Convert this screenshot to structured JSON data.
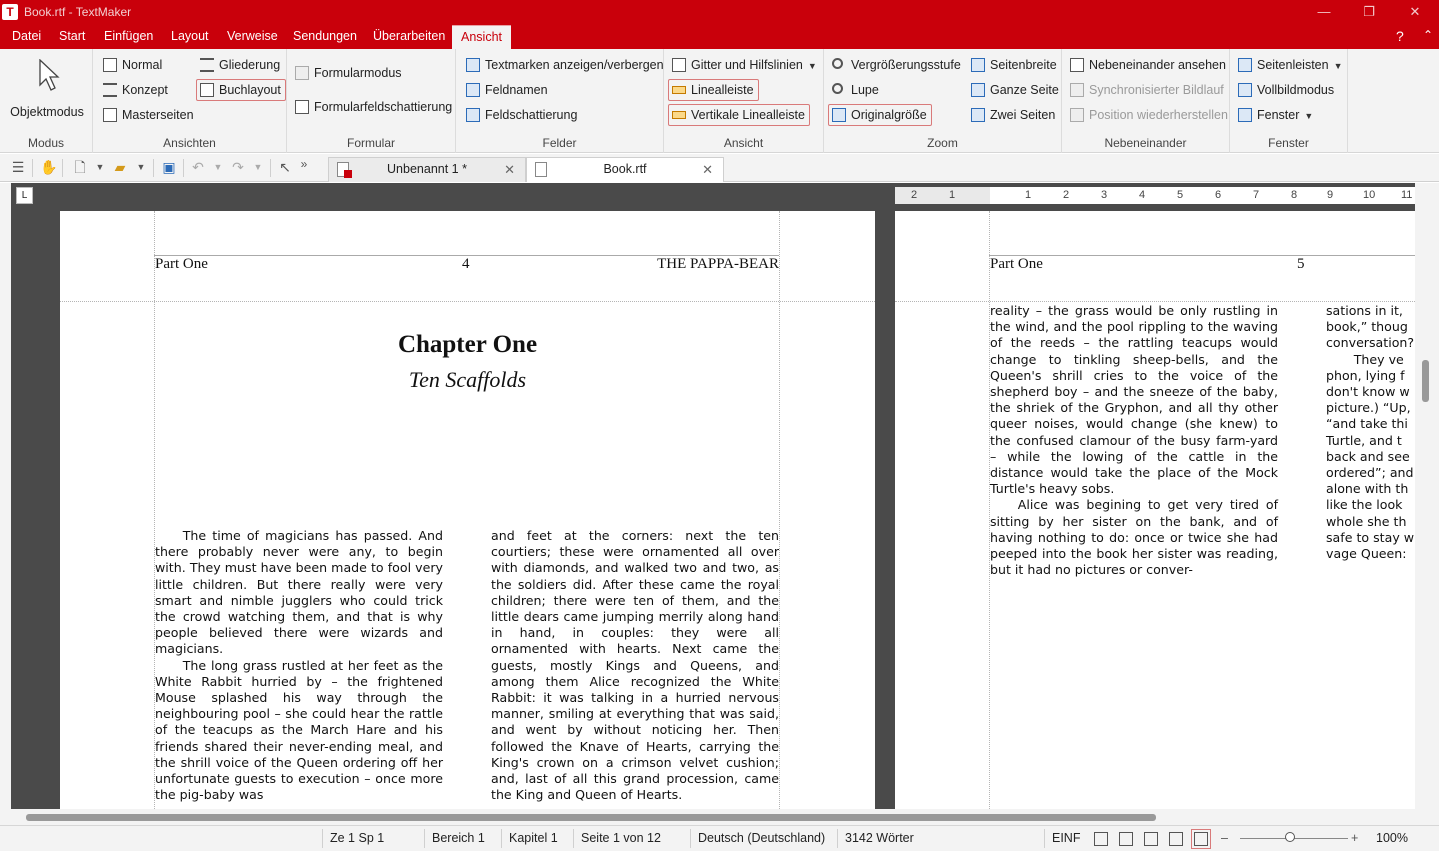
{
  "window": {
    "title": "Book.rtf - TextMaker",
    "app_icon_letter": "T",
    "controls": {
      "minimize": "—",
      "maximize": "❐",
      "close": "✕"
    }
  },
  "menu": {
    "tabs": [
      "Datei",
      "Start",
      "Einfügen",
      "Layout",
      "Verweise",
      "Sendungen",
      "Überarbeiten",
      "Ansicht"
    ],
    "active_tab": "Ansicht",
    "help": "?",
    "collapse": "⌃"
  },
  "ribbon": {
    "modus": {
      "label": "Modus",
      "objektmodus": "Objektmodus"
    },
    "ansichten": {
      "label": "Ansichten",
      "normal": "Normal",
      "konzept": "Konzept",
      "masterseiten": "Masterseiten",
      "gliederung": "Gliederung",
      "buchlayout": "Buchlayout"
    },
    "formular": {
      "label": "Formular",
      "formularmodus": "Formularmodus",
      "formularfeldschattierung": "Formularfeldschattierung"
    },
    "felder": {
      "label": "Felder",
      "textmarken": "Textmarken anzeigen/verbergen",
      "feldnamen": "Feldnamen",
      "feldschattierung": "Feldschattierung"
    },
    "ansicht": {
      "label": "Ansicht",
      "gitter": "Gitter und Hilfslinien",
      "linealleiste": "Linealleiste",
      "vertikale_linealleiste": "Vertikale Linealleiste"
    },
    "zoom": {
      "label": "Zoom",
      "vergroesserungsstufe": "Vergrößerungsstufe",
      "lupe": "Lupe",
      "originalgroesse": "Originalgröße",
      "seitenbreite": "Seitenbreite",
      "ganze_seite": "Ganze Seite",
      "zwei_seiten": "Zwei Seiten"
    },
    "nebeneinander": {
      "label": "Nebeneinander",
      "nebeneinander_ansehen": "Nebeneinander ansehen",
      "synchronisierter_bildlauf": "Synchronisierter Bildlauf",
      "position_wiederherstellen": "Position wiederherstellen"
    },
    "fenster": {
      "label": "Fenster",
      "seitenleisten": "Seitenleisten",
      "vollbildmodus": "Vollbildmodus",
      "fenster": "Fenster"
    }
  },
  "doc_tabs": [
    {
      "name": "Unbenannt 1 *",
      "close": "✕"
    },
    {
      "name": "Book.rtf",
      "close": "✕"
    }
  ],
  "ruler": {
    "corner": "L",
    "numbers": [
      "2",
      "1",
      "1",
      "2",
      "3",
      "4",
      "5",
      "6",
      "7",
      "8",
      "9",
      "10",
      "11"
    ]
  },
  "left_page": {
    "header_left": "Part One",
    "header_center": "4",
    "header_right": "THE PAPPA-BEAR",
    "chapter_title": "Chapter One",
    "chapter_subtitle": "Ten Scaffolds",
    "col1_p1": "The time of magicians has passed. And there probably never were any, to begin with. They must have been made to fool very little children. But there really were very smart and nimble jugglers who could trick the crowd watching them, and that is why people believed there were wizards and magicians.",
    "col1_p2": "The long grass rustled at her feet as the White Rabbit hurried by – the frightened Mouse splashed his way through the neighbouring pool – she could hear the rattle of the teacups as the March Hare and his friends shared their never-ending meal, and the shrill voice of the Queen ordering off her unfortunate guests to execution – once more the pig-baby was",
    "col2_p1": "and feet at the corners: next the ten courtiers; these were ornamented all over with diamonds, and walked two and two, as the soldiers did. After these came the royal children; there were ten of them, and the little dears came jumping merrily along hand in hand, in couples: they were all ornamented with hearts. Next came the guests, mostly Kings and Queens, and among them Alice recognized the White Rabbit: it was talking in a hurried nervous manner, smiling at everything that was said, and went by without noticing her. Then followed the Knave of Hearts, carrying the King's crown on a crimson velvet cushion; and, last of all this grand procession, came the King and Queen of Hearts."
  },
  "right_page": {
    "header_left": "Part One",
    "header_center": "5",
    "col1_p1": "reality – the grass would be only rustling in the wind, and the pool rippling to the waving of the reeds – the rattling teacups would change to tinkling sheep-bells, and the Queen's shrill cries to the voice of the shepherd boy – and the sneeze of the baby, the shriek of the Gryphon, and all thy other queer noises, would change (she knew) to the confused clamour of the busy farm-yard – while the lowing of the cattle in the distance would take the place of the Mock Turtle's heavy sobs.",
    "col1_p2": "Alice was begining to get very tired of sitting by her sister on the bank, and of having nothing to do: once or twice she had peeped into the book her sister was reading, but it had no pictures or conver-",
    "col2_lines": [
      "sations in it,",
      "book,” thoug",
      "conversation?",
      "They ve",
      "phon, lying f",
      "don't know w",
      "picture.) “Up,",
      "“and take thi",
      "Turtle, and t",
      "back and see",
      "ordered”; and",
      "alone with th",
      "like the look",
      "whole she th",
      "safe to stay w",
      "vage Queen:"
    ]
  },
  "status": {
    "position": "Ze 1 Sp 1",
    "bereich": "Bereich 1",
    "kapitel": "Kapitel 1",
    "seite": "Seite 1 von 12",
    "sprache": "Deutsch (Deutschland)",
    "woerter": "3142 Wörter",
    "modus": "EINF",
    "zoom": "100%",
    "zoom_minus": "–",
    "zoom_plus": "+"
  }
}
